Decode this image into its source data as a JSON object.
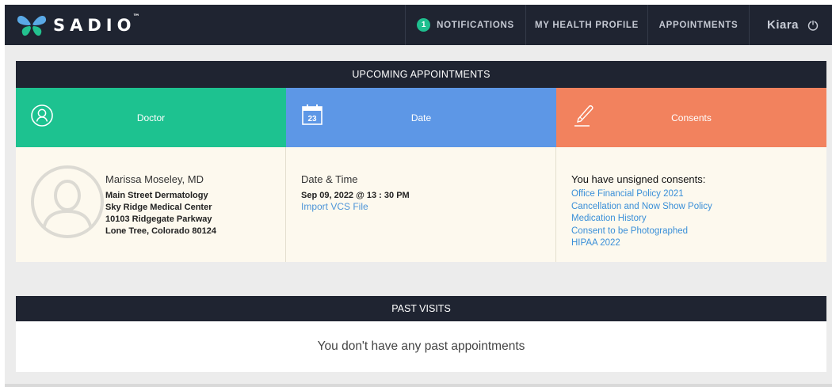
{
  "brand": {
    "name": "SADIO",
    "tm": "™"
  },
  "nav": {
    "notifications": {
      "count": "1",
      "label": "NOTIFICATIONS"
    },
    "profile": "MY HEALTH PROFILE",
    "appointments": "APPOINTMENTS",
    "user": "Kiara"
  },
  "upcoming": {
    "title": "UPCOMING APPOINTMENTS",
    "columns": {
      "doctor": "Doctor",
      "date": "Date",
      "consents": "Consents"
    },
    "calendar_day": "23",
    "doctor": {
      "name": "Marissa Moseley, MD",
      "lines": [
        "Main Street Dermatology",
        "Sky Ridge Medical Center",
        "10103 Ridgegate Parkway",
        "Lone Tree, Colorado 80124"
      ]
    },
    "date": {
      "label": "Date & Time",
      "value": "Sep 09, 2022 @ 13 : 30 PM",
      "import_link": "Import VCS File"
    },
    "consents": {
      "title": "You have unsigned consents:",
      "items": [
        "Office Financial Policy 2021",
        "Cancellation and Now Show Policy",
        "Medication History",
        "Consent to be Photographed",
        "HIPAA 2022"
      ]
    }
  },
  "past": {
    "title": "PAST VISITS",
    "empty": "You don't have any past appointments"
  },
  "colors": {
    "nav_bg": "#1f2431",
    "doctor": "#1dc290",
    "date": "#5d97e6",
    "consents": "#f2825e",
    "badge": "#1fbf8f",
    "link": "#3a8fd8"
  },
  "icons": [
    "butterfly-logo-icon",
    "user-outline-icon",
    "calendar-icon",
    "pen-icon",
    "power-icon",
    "avatar-placeholder-icon"
  ]
}
